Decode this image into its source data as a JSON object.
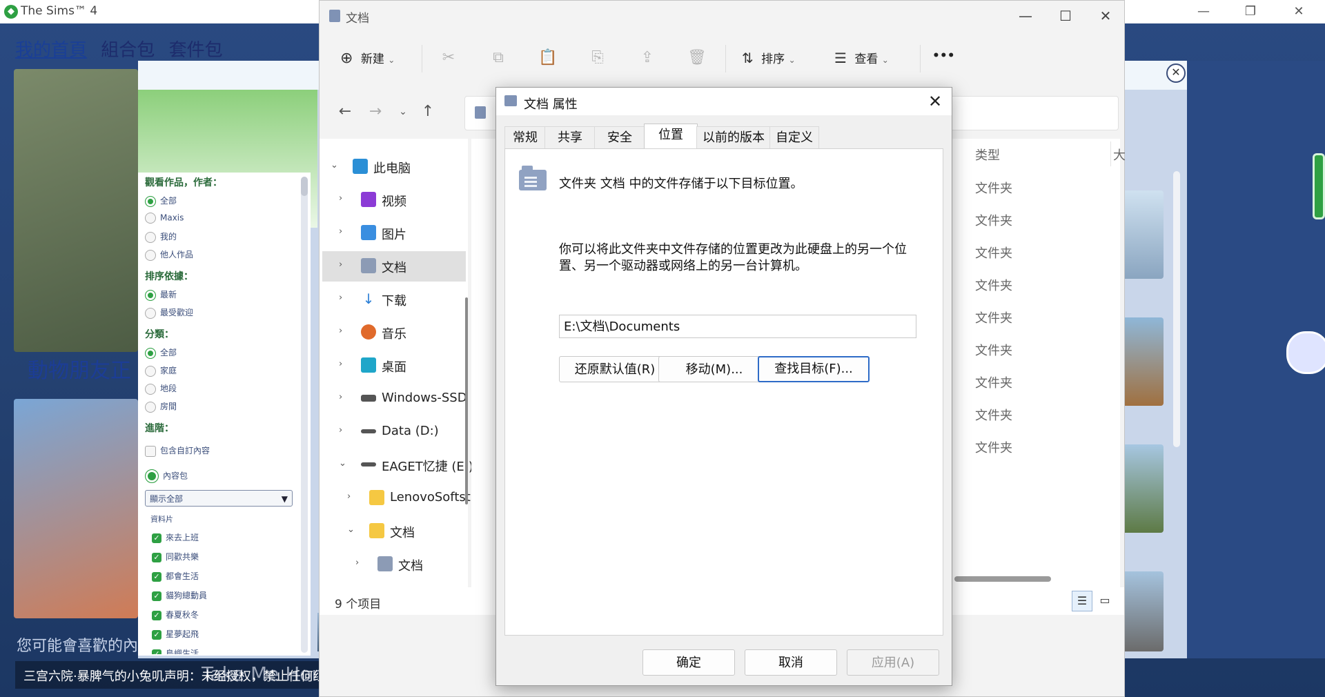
{
  "sims": {
    "window_title": "The Sims™ 4",
    "nav": [
      "我的首頁",
      "組合包",
      "套件包"
    ],
    "heading": "動物朋友正",
    "heading2": "您可能會喜歡的內容",
    "footer_notice": "三宫六院·暴脾气的小兔叽声明：未经授权，禁止任何组织或人员分发、售卖，违者追究法律责任",
    "footer_behind": "Take Me Home",
    "filters": {
      "author_heading": "觀看作品，作者：",
      "author_options": [
        "全部",
        "Maxis",
        "我的",
        "他人作品"
      ],
      "sort_heading": "排序依據：",
      "sort_options": [
        "最新",
        "最受歡迎"
      ],
      "category_heading": "分類：",
      "category_options": [
        "全部",
        "家庭",
        "地段",
        "房間"
      ],
      "advanced_heading": "進階：",
      "include_custom": "包含自訂內容",
      "content_pack_label": "內容包",
      "select_value": "顯示全部",
      "packs_heading": "資料片",
      "packs": [
        "來去上班",
        "同歡共樂",
        "都會生活",
        "貓狗總動員",
        "春夏秋冬",
        "星夢起飛",
        "島嶼生活"
      ]
    }
  },
  "explorer": {
    "window_title": "文档",
    "toolbar": {
      "new_label": "新建",
      "sort_label": "排序",
      "view_label": "查看",
      "more_label": "•••"
    },
    "tree": [
      {
        "label": "此电脑",
        "expanded": true
      },
      {
        "label": "视频"
      },
      {
        "label": "图片"
      },
      {
        "label": "文档",
        "selected": true
      },
      {
        "label": "下载"
      },
      {
        "label": "音乐"
      },
      {
        "label": "桌面"
      },
      {
        "label": "Windows-SSD"
      },
      {
        "label": "Data (D:)"
      },
      {
        "label": "EAGET忆捷 (E:)",
        "expanded": true
      },
      {
        "label": "LenovoSoftst"
      },
      {
        "label": "文档",
        "expanded": true
      },
      {
        "label": "文档"
      }
    ],
    "columns": {
      "type": "类型",
      "size": "大"
    },
    "rows_type": [
      "文件夹",
      "文件夹",
      "文件夹",
      "文件夹",
      "文件夹",
      "文件夹",
      "文件夹",
      "文件夹",
      "文件夹"
    ],
    "status": "9 个项目"
  },
  "props": {
    "title": "文档 属性",
    "tabs": [
      "常规",
      "共享",
      "安全",
      "位置",
      "以前的版本",
      "自定义"
    ],
    "active_tab": "位置",
    "description": "文件夹 文档 中的文件存储于以下目标位置。",
    "hint": "你可以将此文件夹中文件存储的位置更改为此硬盘上的另一个位置、另一个驱动器或网络上的另一台计算机。",
    "path": "E:\\文档\\Documents",
    "buttons": {
      "restore": "还原默认值(R)",
      "move": "移动(M)...",
      "find": "查找目标(F)..."
    },
    "dialog_buttons": {
      "ok": "确定",
      "cancel": "取消",
      "apply": "应用(A)"
    }
  },
  "colors": {
    "sims_green": "#2ea043",
    "focus_blue": "#2e6bc7",
    "sims_bg": "#2a4a82"
  }
}
